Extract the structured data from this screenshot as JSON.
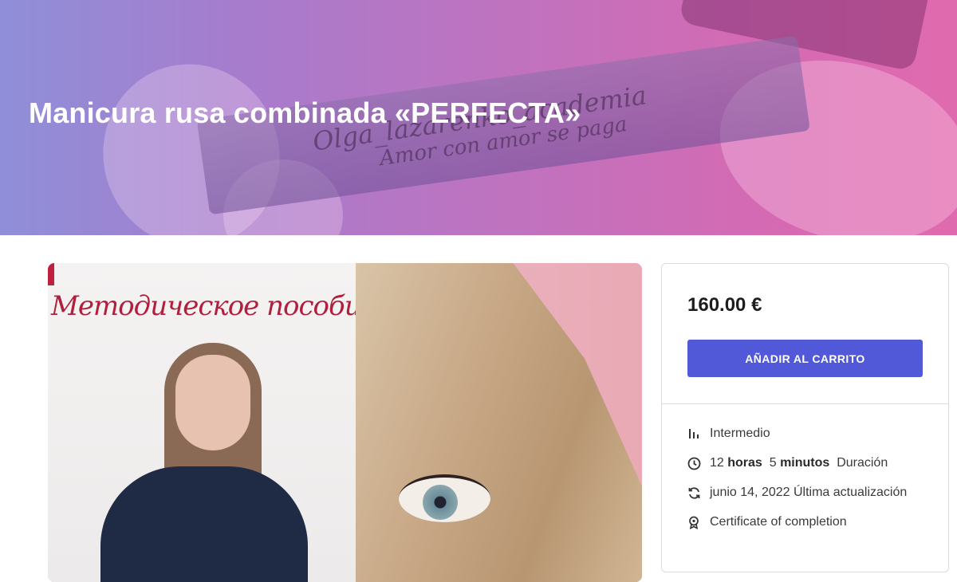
{
  "hero": {
    "title": "Manicura rusa combinada «PERFECTA»",
    "engraving_line1": "Olga_lazarenko_academia",
    "engraving_line2": "Amor con amor se paga"
  },
  "media": {
    "book_title": "Методическое пособие"
  },
  "sidebar": {
    "price": "160.00 €",
    "add_to_cart_label": "AÑADIR AL CARRITO",
    "level": "Intermedio",
    "duration_hours": "12",
    "duration_hours_unit": "horas",
    "duration_minutes": "5",
    "duration_minutes_unit": "minutos",
    "duration_label": "Duración",
    "updated_date": "junio 14, 2022",
    "updated_label": "Última actualización",
    "certificate": "Certificate of completion"
  },
  "icons": {
    "level": "bars-icon",
    "duration": "clock-icon",
    "updated": "refresh-icon",
    "certificate": "award-icon"
  },
  "colors": {
    "accent": "#5159d9",
    "hero_start": "#8f8fd8",
    "hero_end": "#e06aae"
  }
}
